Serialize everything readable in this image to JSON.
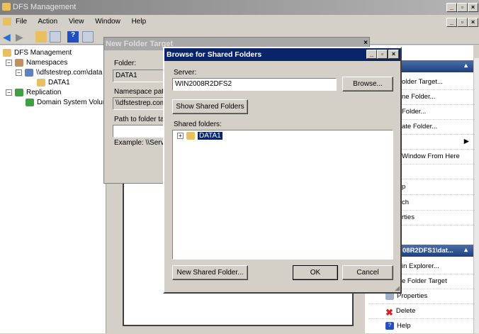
{
  "window": {
    "title": "DFS Management"
  },
  "menu": [
    "File",
    "Action",
    "View",
    "Window",
    "Help"
  ],
  "tree": {
    "root": "DFS Management",
    "namespaces": "Namespaces",
    "namespace": "\\\\dfstestrep.com\\data",
    "folder": "DATA1",
    "replication": "Replication",
    "dsv": "Domain System Volume"
  },
  "actions": {
    "header1": "",
    "items1": [
      "older Target...",
      "ne Folder...",
      "Folder...",
      "ate Folder...",
      "",
      "Window From Here",
      "",
      "p",
      "ch",
      "rties"
    ],
    "header2": "08R2DFS1\\dat...",
    "items2": [
      "in Explorer...",
      "e Folder Target",
      "Properties",
      "Delete",
      "Help"
    ]
  },
  "new_folder_target": {
    "title": "New Folder Target",
    "folder_label": "Folder:",
    "folder_value": "DATA1",
    "ns_label": "Namespace path:",
    "ns_value": "\\\\dfstestrep.com\\",
    "path_label": "Path to folder target:",
    "path_value": "",
    "example": "Example: \\\\Server"
  },
  "browse": {
    "title": "Browse for Shared Folders",
    "server_label": "Server:",
    "server_value": "WIN2008R2DFS2",
    "browse_btn": "Browse...",
    "show_btn": "Show Shared Folders",
    "shared_label": "Shared folders:",
    "shared": [
      "DATA1"
    ],
    "new_btn": "New Shared Folder...",
    "ok": "OK",
    "cancel": "Cancel"
  }
}
